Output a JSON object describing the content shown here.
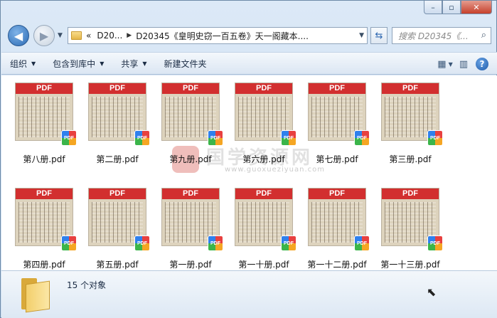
{
  "window": {
    "caption": {
      "minimize": "–",
      "maximize": "▫",
      "close": "✕"
    }
  },
  "nav": {
    "address": {
      "chevron": "«",
      "crumbs": [
        "D20...",
        "D20345《皇明史窃一百五卷》天一阁藏本...."
      ]
    },
    "search_placeholder": "搜索 D20345《..."
  },
  "toolbar": {
    "organize": "组织",
    "include_in_library": "包含到库中",
    "share": "共享",
    "new_folder": "新建文件夹"
  },
  "files": {
    "thumb_band_label": "PDF",
    "badge_label": "PDF",
    "items": [
      {
        "name": "第八册.pdf"
      },
      {
        "name": "第二册.pdf"
      },
      {
        "name": "第九册.pdf"
      },
      {
        "name": "第六册.pdf"
      },
      {
        "name": "第七册.pdf"
      },
      {
        "name": "第三册.pdf"
      },
      {
        "name": "第四册.pdf"
      },
      {
        "name": "第五册.pdf"
      },
      {
        "name": "第一册.pdf"
      },
      {
        "name": "第一十册.pdf"
      },
      {
        "name": "第一十二册.pdf"
      },
      {
        "name": "第一十三册.pdf"
      }
    ]
  },
  "watermark": {
    "text": "国学资源网",
    "url": "www.guoxueziyuan.com"
  },
  "status": {
    "count_text": "15 个对象"
  },
  "colors": {
    "pdf_red": "#d22f2f",
    "window_frame": "#dce9f7"
  }
}
